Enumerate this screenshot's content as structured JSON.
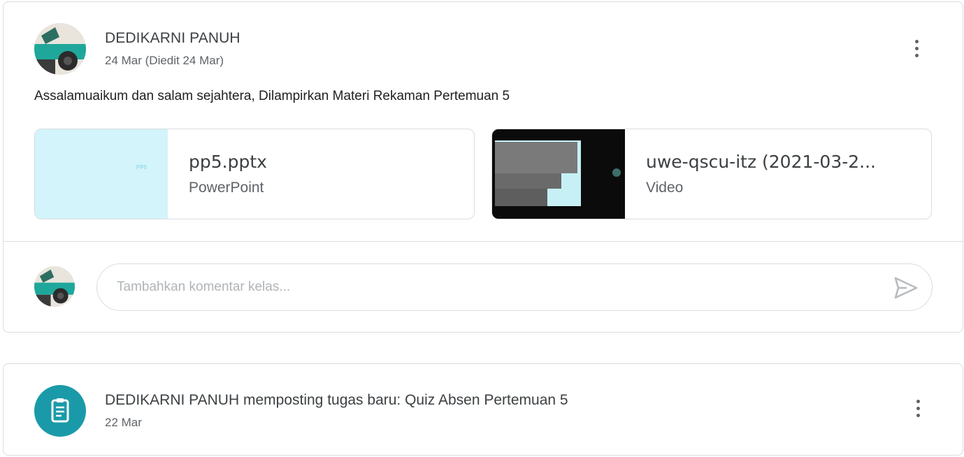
{
  "post": {
    "author": "DEDIKARNI PANUH",
    "date": "24 Mar (Diedit 24 Mar)",
    "text": "Assalamuaikum dan salam sejahtera, Dilampirkan Materi Rekaman Pertemuan 5",
    "attachments": [
      {
        "title": "pp5.pptx",
        "type": "PowerPoint",
        "thumb_label": "PP5"
      },
      {
        "title": "uwe-qscu-itz (2021-03-2...",
        "type": "Video"
      }
    ],
    "comment": {
      "placeholder": "Tambahkan komentar kelas..."
    },
    "icons": {
      "menu": "more-vert-icon",
      "send": "send-icon"
    }
  },
  "task": {
    "title": "DEDIKARNI PANUH memposting tugas baru: Quiz Absen Pertemuan 5",
    "date": "22 Mar",
    "icons": {
      "type": "assignment-icon",
      "menu": "more-vert-icon"
    }
  },
  "colors": {
    "accent": "#1a9aa8",
    "pptx_thumb": "#d2f4fa",
    "border": "#dadce0",
    "text": "#3c4043",
    "secondary_text": "#5f6368"
  }
}
